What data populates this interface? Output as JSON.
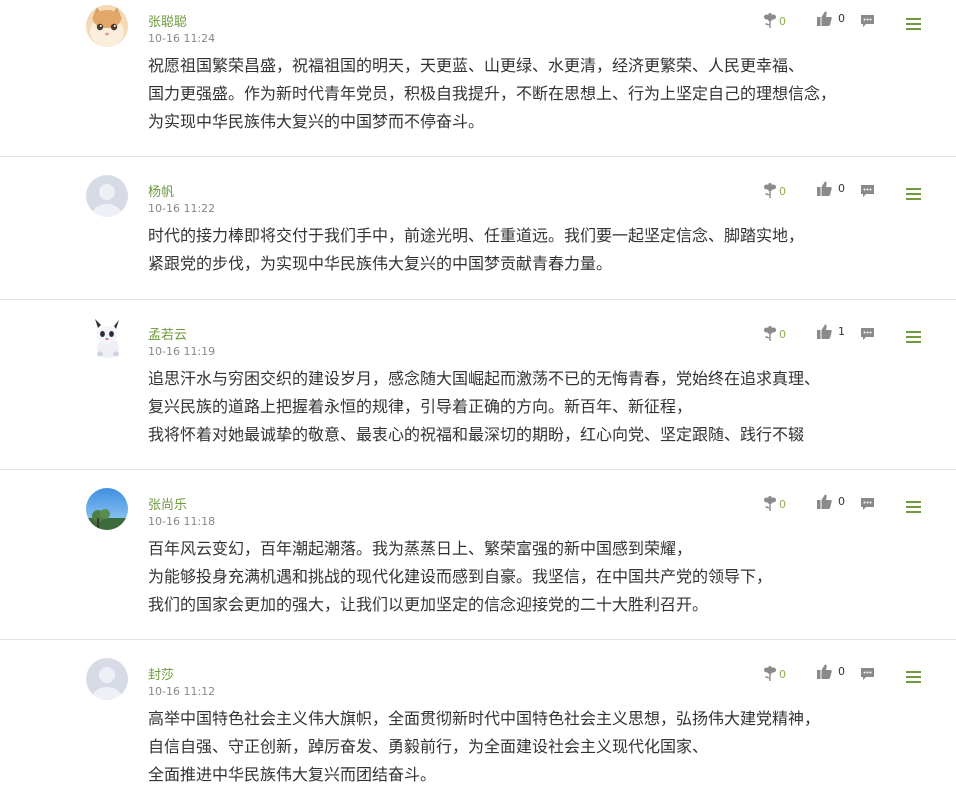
{
  "colors": {
    "accent": "#6f9a3d",
    "text": "#333333",
    "muted": "#888888",
    "divider": "#e3e3e3"
  },
  "icons": {
    "flower": "flower-icon",
    "like": "thumbs-up-icon",
    "reply": "chat-icon",
    "menu": "menu-icon"
  },
  "comments": [
    {
      "avatar": "cat-avatar",
      "name": "张聪聪",
      "time": "10-16 11:24",
      "flowers": "0",
      "likes": "0",
      "lines": [
        "祝愿祖国繁荣昌盛，祝福祖国的明天，天更蓝、山更绿、水更清，经济更繁荣、人民更幸福、",
        "国力更强盛。作为新时代青年党员，积极自我提升，不断在思想上、行为上坚定自己的理想信念，",
        "为实现中华民族伟大复兴的中国梦而不停奋斗。"
      ]
    },
    {
      "avatar": "default-avatar",
      "name": "杨帆",
      "time": "10-16 11:22",
      "flowers": "0",
      "likes": "0",
      "lines": [
        "时代的接力棒即将交付于我们手中，前途光明、任重道远。我们要一起坚定信念、脚踏实地，",
        "紧跟党的步伐，为实现中华民族伟大复兴的中国梦贡献青春力量。"
      ]
    },
    {
      "avatar": "panda-avatar",
      "name": "孟若云",
      "time": "10-16 11:19",
      "flowers": "0",
      "likes": "1",
      "lines": [
        "追思汗水与穷困交织的建设岁月，感念随大国崛起而激荡不已的无悔青春，党始终在追求真理、",
        "复兴民族的道路上把握着永恒的规律，引导着正确的方向。新百年、新征程，",
        "我将怀着对她最诚挚的敬意、最衷心的祝福和最深切的期盼，红心向党、坚定跟随、践行不辍"
      ]
    },
    {
      "avatar": "sky-avatar",
      "name": "张尚乐",
      "time": "10-16 11:18",
      "flowers": "0",
      "likes": "0",
      "lines": [
        "百年风云变幻，百年潮起潮落。我为蒸蒸日上、繁荣富强的新中国感到荣耀，",
        "为能够投身充满机遇和挑战的现代化建设而感到自豪。我坚信，在中国共产党的领导下，",
        "我们的国家会更加的强大，让我们以更加坚定的信念迎接党的二十大胜利召开。"
      ]
    },
    {
      "avatar": "default-avatar",
      "name": "封莎",
      "time": "10-16 11:12",
      "flowers": "0",
      "likes": "0",
      "lines": [
        "高举中国特色社会主义伟大旗帜，全面贯彻新时代中国特色社会主义思想，弘扬伟大建党精神，",
        "自信自强、守正创新，踔厉奋发、勇毅前行，为全面建设社会主义现代化国家、",
        "全面推进中华民族伟大复兴而团结奋斗。"
      ]
    }
  ]
}
